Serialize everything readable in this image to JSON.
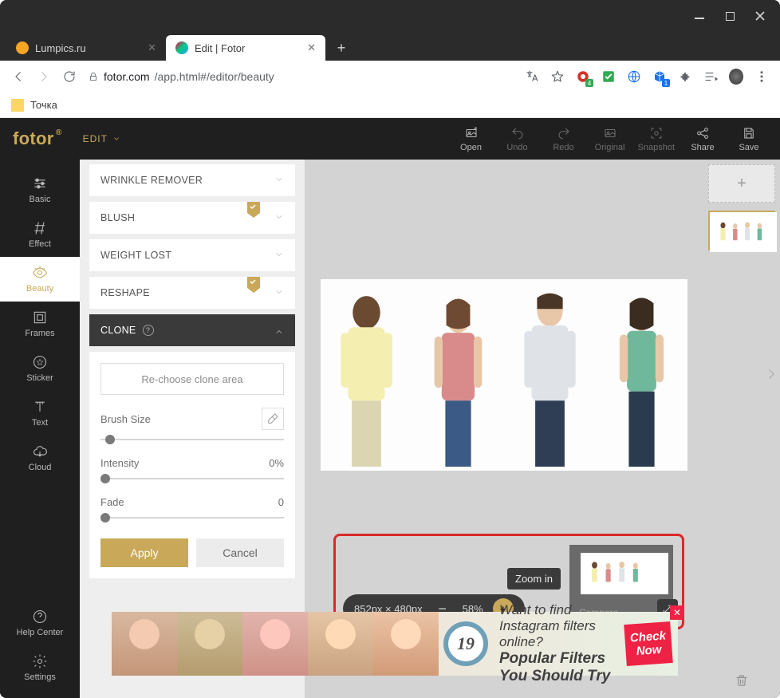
{
  "window": {
    "tabs": [
      {
        "label": "Lumpics.ru",
        "favicon_color": "#f6a623"
      },
      {
        "label": "Edit | Fotor",
        "favicon_color": "linear"
      }
    ]
  },
  "address": {
    "domain": "fotor.com",
    "path": "/app.html#/editor/beauty",
    "badge_ob": "4",
    "badge_cube": "1"
  },
  "bookmark": {
    "label": "Точка"
  },
  "header": {
    "logo": "fotor",
    "edit_label": "EDIT",
    "toolbar": [
      {
        "id": "open",
        "label": "Open"
      },
      {
        "id": "undo",
        "label": "Undo"
      },
      {
        "id": "redo",
        "label": "Redo"
      },
      {
        "id": "original",
        "label": "Original"
      },
      {
        "id": "snapshot",
        "label": "Snapshot"
      },
      {
        "id": "share",
        "label": "Share"
      },
      {
        "id": "save",
        "label": "Save"
      }
    ]
  },
  "sidebar": {
    "items": [
      {
        "id": "basic",
        "label": "Basic"
      },
      {
        "id": "effect",
        "label": "Effect"
      },
      {
        "id": "beauty",
        "label": "Beauty"
      },
      {
        "id": "frames",
        "label": "Frames"
      },
      {
        "id": "sticker",
        "label": "Sticker"
      },
      {
        "id": "text",
        "label": "Text"
      },
      {
        "id": "cloud",
        "label": "Cloud"
      }
    ],
    "bottom": [
      {
        "id": "help",
        "label": "Help Center"
      },
      {
        "id": "settings",
        "label": "Settings"
      }
    ]
  },
  "accordion": {
    "items": [
      {
        "id": "wrinkle",
        "label": "WRINKLE REMOVER",
        "badge": false
      },
      {
        "id": "blush",
        "label": "BLUSH",
        "badge": true
      },
      {
        "id": "weight",
        "label": "WEIGHT LOST",
        "badge": false
      },
      {
        "id": "reshape",
        "label": "RESHAPE",
        "badge": true
      },
      {
        "id": "clone",
        "label": "CLONE",
        "badge": false,
        "active": true
      }
    ]
  },
  "clone_panel": {
    "rechoose": "Re-choose clone area",
    "brush_label": "Brush Size",
    "intensity_label": "Intensity",
    "intensity_val": "0%",
    "fade_label": "Fade",
    "fade_val": "0",
    "apply": "Apply",
    "cancel": "Cancel"
  },
  "zoom": {
    "dimensions": "852px × 480px",
    "percent": "58%",
    "tooltip": "Zoom in",
    "compare": "Compare"
  },
  "ad": {
    "num": "19",
    "line1": "Want to find Instagram filters online?",
    "line2": "Popular Filters You Should Try",
    "cta1": "Check",
    "cta2": "Now"
  }
}
